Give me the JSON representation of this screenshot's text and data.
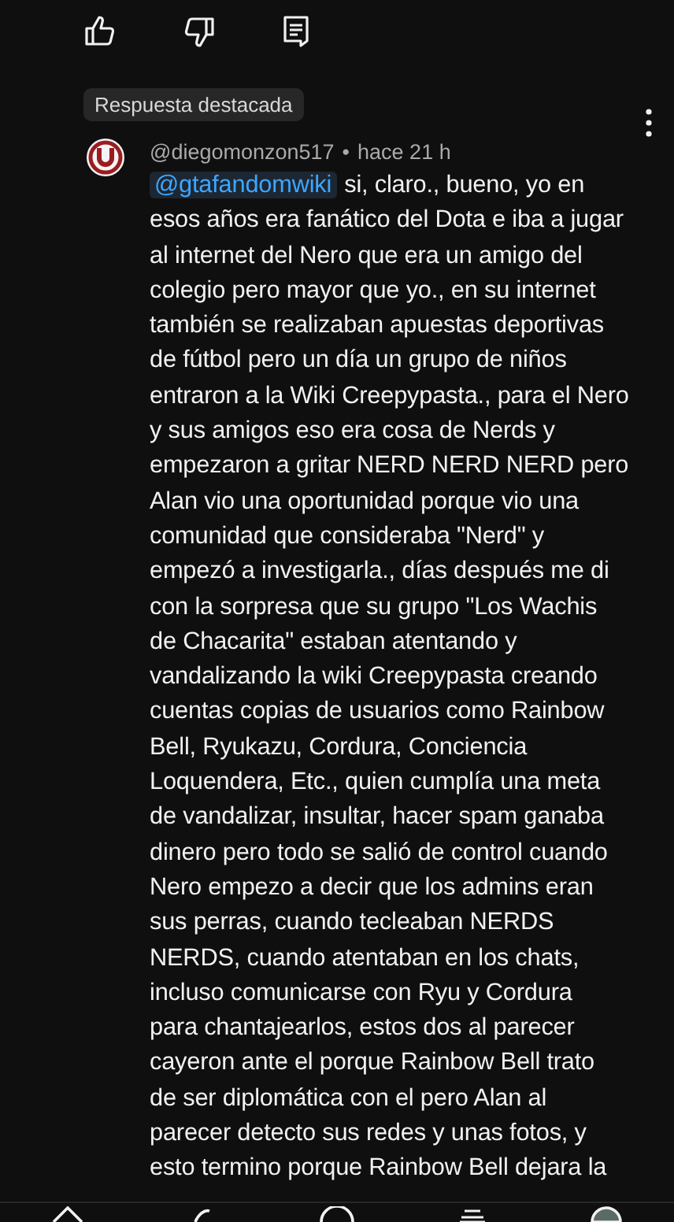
{
  "actions": [
    {
      "kind": "like"
    },
    {
      "kind": "dislike"
    },
    {
      "kind": "reply"
    }
  ],
  "badge": "Respuesta destacada",
  "comment": {
    "author": "@diegomonzon517",
    "separator": "•",
    "time": "hace 21 h",
    "mention": "@gtafandomwiki",
    "lines": [
      "si, claro., bueno, yo en",
      "esos años era fanático del Dota e iba a jugar",
      "al internet del Nero que era un amigo del",
      "colegio pero mayor que yo., en su internet",
      "también se realizaban apuestas deportivas",
      "de fútbol pero un día un grupo de niños",
      "entraron a la Wiki Creepypasta., para el Nero",
      "y sus amigos eso era cosa de Nerds y",
      "empezaron a gritar NERD NERD NERD pero",
      "Alan vio una oportunidad porque vio una",
      "comunidad que consideraba \"Nerd\" y",
      "empezó a investigarla., días después me di",
      "con la sorpresa que su grupo \"Los Wachis",
      "de Chacarita\" estaban atentando y",
      "vandalizando la wiki Creepypasta creando",
      "cuentas copias de usuarios como Rainbow",
      "Bell, Ryukazu, Cordura, Conciencia",
      "Loquendera, Etc., quien cumplía una meta",
      "de vandalizar, insultar, hacer spam ganaba",
      "dinero pero todo se salió de control cuando",
      "Nero empezo a decir que los admins eran",
      "sus perras, cuando tecleaban NERDS",
      "NERDS, cuando atentaban en los chats,",
      "incluso comunicarse con Ryu y Cordura",
      "para chantajearlos, estos dos al parecer",
      "cayeron ante el porque Rainbow Bell trato",
      "de ser diplomática con el pero Alan al",
      "parecer detecto sus redes y unas fotos, y",
      "esto termino porque Rainbow Bell dejara la"
    ]
  },
  "nav": [
    {
      "kind": "home"
    },
    {
      "kind": "shorts"
    },
    {
      "kind": "create"
    },
    {
      "kind": "subscriptions"
    },
    {
      "kind": "you"
    }
  ]
}
